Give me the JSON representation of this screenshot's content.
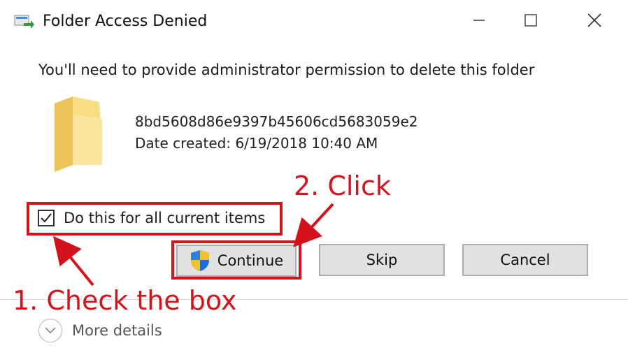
{
  "window": {
    "title": "Folder Access Denied",
    "icons": {
      "app": "folder-move-icon",
      "minimize": "minimize-icon",
      "maximize": "maximize-icon",
      "close": "close-icon"
    }
  },
  "message": "You'll need to provide administrator permission to delete this folder",
  "folder": {
    "icon": "folder-icon",
    "name": "8bd5608d86e9397b45606cd5683059e2",
    "date_created": "Date created: 6/19/2018 10:40 AM"
  },
  "checkbox": {
    "label": "Do this for all current items",
    "checked": true
  },
  "buttons": {
    "continue_label": "Continue",
    "continue_icon": "uac-shield-icon",
    "skip_label": "Skip",
    "cancel_label": "Cancel"
  },
  "details": {
    "label": "More details",
    "icon": "chevron-down-icon"
  },
  "annotations": {
    "step1": "1. Check the box",
    "step2": "2. Click",
    "color": "#d4121b"
  }
}
